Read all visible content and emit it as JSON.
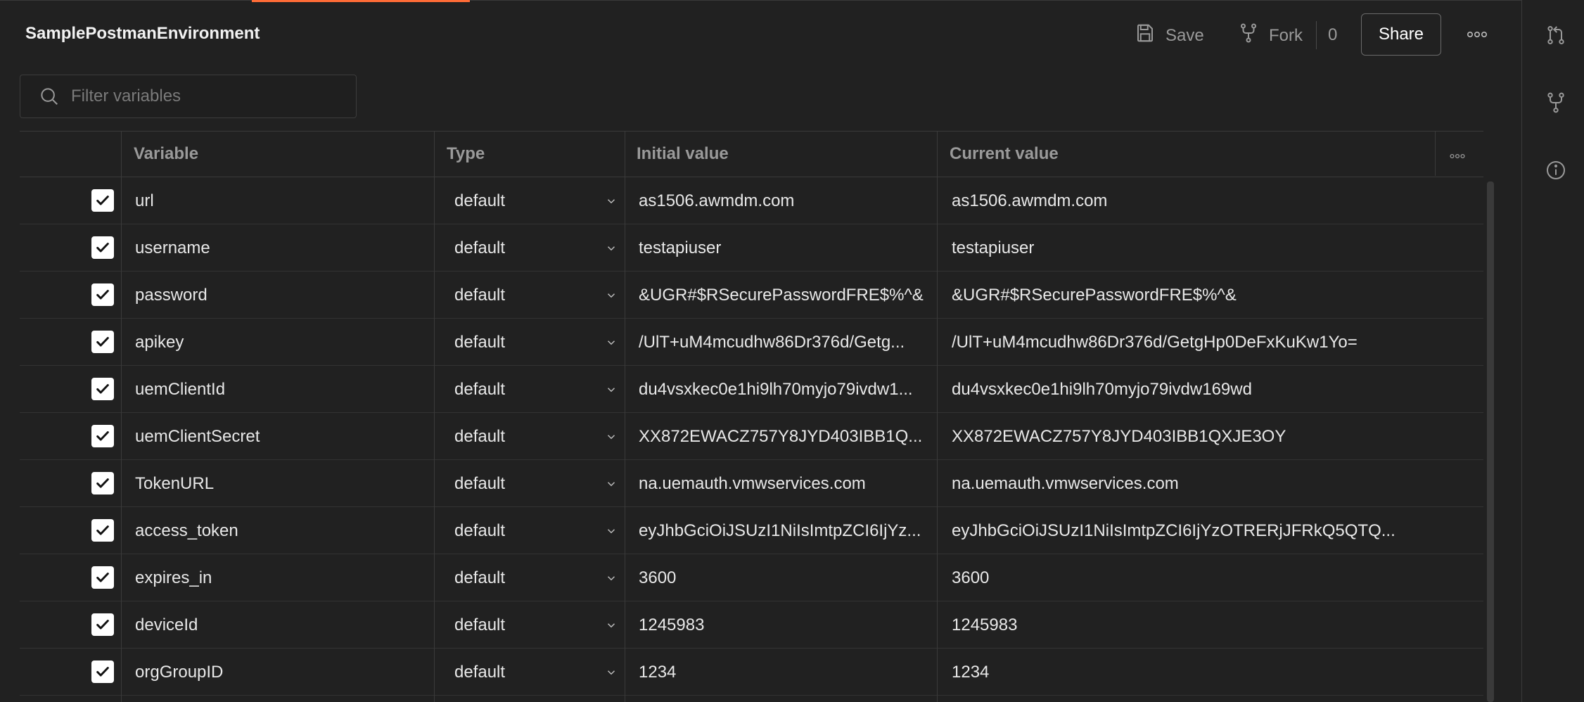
{
  "environment": {
    "title": "SamplePostmanEnvironment"
  },
  "toolbar": {
    "save_label": "Save",
    "fork_label": "Fork",
    "fork_count": "0",
    "share_label": "Share"
  },
  "search": {
    "placeholder": "Filter variables"
  },
  "table": {
    "headers": {
      "variable": "Variable",
      "type": "Type",
      "initial": "Initial value",
      "current": "Current value"
    },
    "rows": [
      {
        "variable": "url",
        "type": "default",
        "initial": "as1506.awmdm.com",
        "current": "as1506.awmdm.com",
        "enabled": true
      },
      {
        "variable": "username",
        "type": "default",
        "initial": "testapiuser",
        "current": "testapiuser",
        "enabled": true
      },
      {
        "variable": "password",
        "type": "default",
        "initial": "&UGR#$RSecurePasswordFRE$%^&",
        "current": "&UGR#$RSecurePasswordFRE$%^&",
        "enabled": true
      },
      {
        "variable": "apikey",
        "type": "default",
        "initial": "/UlT+uM4mcudhw86Dr376d/Getg...",
        "current": "/UlT+uM4mcudhw86Dr376d/GetgHp0DeFxKuKw1Yo=",
        "enabled": true
      },
      {
        "variable": "uemClientId",
        "type": "default",
        "initial": "du4vsxkec0e1hi9lh70myjo79ivdw1...",
        "current": "du4vsxkec0e1hi9lh70myjo79ivdw169wd",
        "enabled": true
      },
      {
        "variable": "uemClientSecret",
        "type": "default",
        "initial": "XX872EWACZ757Y8JYD403IBB1Q...",
        "current": "XX872EWACZ757Y8JYD403IBB1QXJE3OY",
        "enabled": true
      },
      {
        "variable": "TokenURL",
        "type": "default",
        "initial": "na.uemauth.vmwservices.com",
        "current": "na.uemauth.vmwservices.com",
        "enabled": true
      },
      {
        "variable": "access_token",
        "type": "default",
        "initial": "eyJhbGciOiJSUzI1NiIsImtpZCI6IjYz...",
        "current": "eyJhbGciOiJSUzI1NiIsImtpZCI6IjYzOTRERjJFRkQ5QTQ...",
        "enabled": true
      },
      {
        "variable": "expires_in",
        "type": "default",
        "initial": "3600",
        "current": "3600",
        "enabled": true
      },
      {
        "variable": "deviceId",
        "type": "default",
        "initial": "1245983",
        "current": "1245983",
        "enabled": true
      },
      {
        "variable": "orgGroupID",
        "type": "default",
        "initial": "1234",
        "current": "1234",
        "enabled": true
      }
    ]
  },
  "icons": {
    "save": "save-icon",
    "fork": "fork-icon",
    "more": "more-horizontal-icon",
    "rail": [
      "pull-request-icon",
      "fork-icon",
      "info-icon"
    ],
    "search": "search-icon"
  },
  "colors": {
    "accent": "#ff6c37",
    "background": "#212121"
  }
}
